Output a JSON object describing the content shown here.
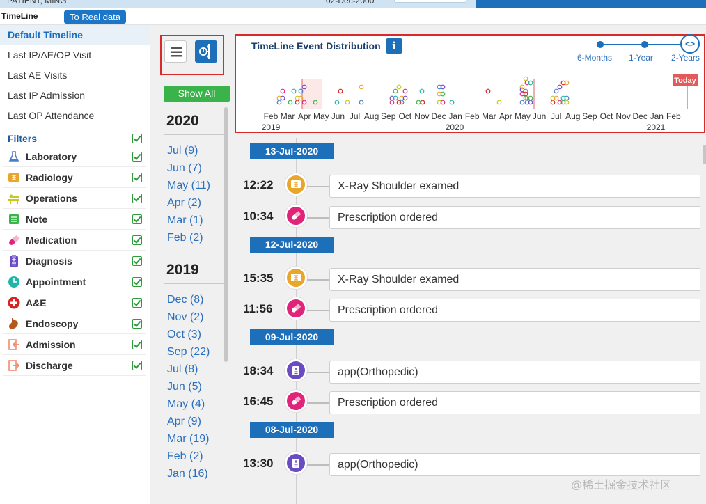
{
  "topstrip": {
    "patient": "PATIENT, MING",
    "date": "02-Dec-2000"
  },
  "appbar": {
    "title": "TimeLine",
    "real_data_button": "To Real data"
  },
  "sidebar": {
    "nav": [
      {
        "label": "Default Timeline",
        "active": true
      },
      {
        "label": "Last IP/AE/OP Visit"
      },
      {
        "label": "Last AE Visits"
      },
      {
        "label": "Last IP Admission"
      },
      {
        "label": "Last OP Attendance"
      }
    ],
    "filters_label": "Filters",
    "filters": [
      {
        "label": "Laboratory",
        "icon": "flask-icon",
        "color": "#4a7fc8",
        "checked": true
      },
      {
        "label": "Radiology",
        "icon": "xray-icon",
        "color": "#e8a72c",
        "checked": true
      },
      {
        "label": "Operations",
        "icon": "operating-table-icon",
        "color": "#c9c81c",
        "checked": true
      },
      {
        "label": "Note",
        "icon": "note-icon",
        "color": "#3ab44a",
        "checked": true
      },
      {
        "label": "Medication",
        "icon": "pill-icon",
        "color": "#e0247a",
        "checked": true
      },
      {
        "label": "Diagnosis",
        "icon": "clipboard-icon",
        "color": "#6a4bc4",
        "checked": true
      },
      {
        "label": "Appointment",
        "icon": "clock-icon",
        "color": "#1fb5a8",
        "checked": true
      },
      {
        "label": "A&E",
        "icon": "red-cross-icon",
        "color": "#d62424",
        "checked": true
      },
      {
        "label": "Endoscopy",
        "icon": "stomach-icon",
        "color": "#b5581e",
        "checked": true
      },
      {
        "label": "Admission",
        "icon": "admission-icon",
        "color": "#f28b6e",
        "checked": true
      },
      {
        "label": "Discharge",
        "icon": "discharge-icon",
        "color": "#f28b6e",
        "checked": true
      }
    ]
  },
  "midcol": {
    "show_all": "Show All",
    "years": [
      {
        "year": "2020",
        "months": [
          "Jul (9)",
          "Jun (7)",
          "May (11)",
          "Apr (2)",
          "Mar (1)",
          "Feb (2)"
        ]
      },
      {
        "year": "2019",
        "months": [
          "Dec (8)",
          "Nov (2)",
          "Oct (3)",
          "Sep (22)",
          "Jul (8)",
          "Jun (5)",
          "May (4)",
          "Apr (9)",
          "Mar (19)",
          "Feb (2)",
          "Jan (16)"
        ]
      }
    ]
  },
  "distribution": {
    "title": "TimeLine Event Distribution",
    "range_options": [
      "6-Months",
      "1-Year",
      "2-Years"
    ],
    "selected_range": "2-Years",
    "axis_months": [
      "Feb",
      "Mar",
      "Apr",
      "May",
      "Jun",
      "Jul",
      "Aug",
      "Sep",
      "Oct",
      "Nov",
      "Dec",
      "Jan",
      "Feb",
      "Mar",
      "Apr",
      "May",
      "Jun",
      "Jul",
      "Aug",
      "Sep",
      "Oct",
      "Nov",
      "Dec",
      "Jan",
      "Feb"
    ],
    "axis_years": [
      "2019",
      "2020",
      "2021"
    ],
    "today_label": "Today"
  },
  "timeline": {
    "groups": [
      {
        "date": "13-Jul-2020",
        "events": [
          {
            "time": "12:22",
            "text": "X-Ray Shoulder examed",
            "type": "radiology"
          },
          {
            "time": "10:34",
            "text": "Prescription ordered",
            "type": "medication"
          }
        ]
      },
      {
        "date": "12-Jul-2020",
        "events": [
          {
            "time": "15:35",
            "text": "X-Ray Shoulder examed",
            "type": "radiology"
          },
          {
            "time": "11:56",
            "text": "Prescription ordered",
            "type": "medication"
          }
        ]
      },
      {
        "date": "09-Jul-2020",
        "events": [
          {
            "time": "18:34",
            "text": "app(Orthopedic)",
            "type": "diagnosis"
          },
          {
            "time": "16:45",
            "text": "Prescription ordered",
            "type": "medication"
          }
        ]
      },
      {
        "date": "08-Jul-2020",
        "events": [
          {
            "time": "13:30",
            "text": "app(Orthopedic)",
            "type": "diagnosis"
          }
        ]
      }
    ]
  },
  "colors": {
    "accent": "#1c6fb8",
    "green": "#3ab44a",
    "highlight_border": "#d82a2a"
  },
  "watermark": "@稀土掘金技术社区"
}
